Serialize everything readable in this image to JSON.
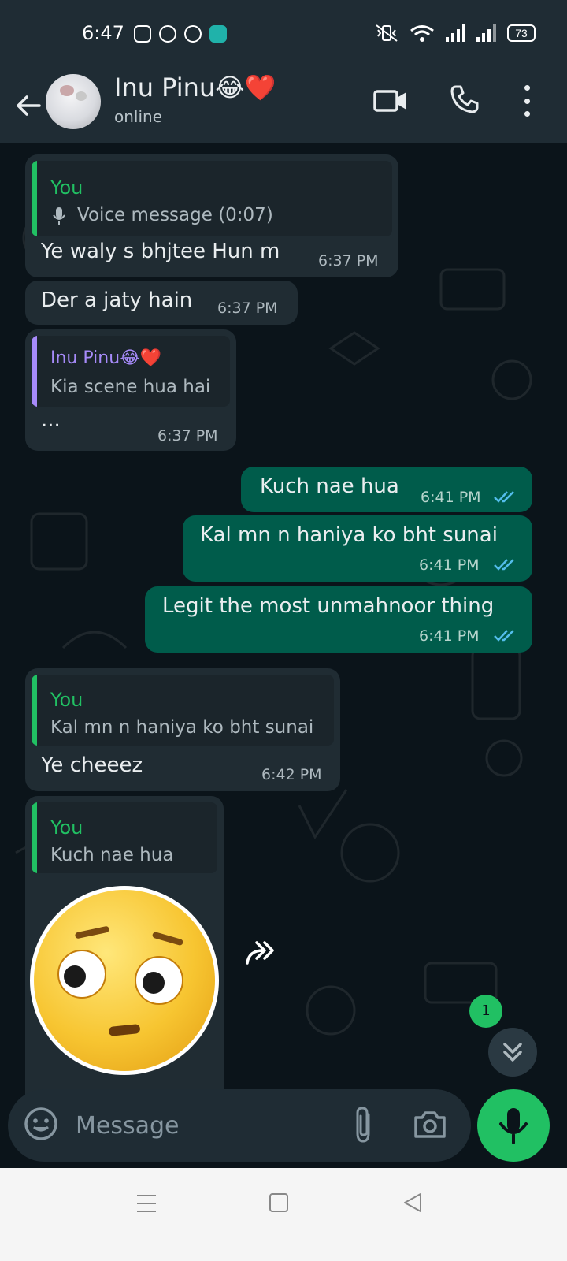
{
  "status_bar": {
    "time": "6:47",
    "battery": "73"
  },
  "header": {
    "contact_name": "Inu Pinu😂❤️",
    "contact_status": "online"
  },
  "messages": [
    {
      "quote_author": "You",
      "quote_text": "Voice message (0:07)",
      "text": "Ye waly s bhjtee Hun m",
      "time": "6:37 PM"
    },
    {
      "text": "Der a jaty hain",
      "time": "6:37 PM"
    },
    {
      "quote_author": "Inu Pinu😂❤️",
      "quote_text": "Kia scene hua hai",
      "text": "...",
      "time": "6:37 PM"
    },
    {
      "text": "Kuch nae hua",
      "time": "6:41 PM"
    },
    {
      "text": "Kal mn n haniya ko bht sunai",
      "time": "6:41 PM"
    },
    {
      "text": "Legit the most unmahnoor thing",
      "time": "6:41 PM"
    },
    {
      "quote_author": "You",
      "quote_text": "Kal mn n haniya ko bht sunai",
      "text": "Ye cheeez",
      "time": "6:42 PM"
    },
    {
      "quote_author": "You",
      "quote_text": "Kuch nae hua"
    }
  ],
  "unread_count": "1",
  "composer": {
    "placeholder": "Message"
  },
  "colors": {
    "accent_green": "#21c063",
    "outgoing_bubble": "#005c4b",
    "incoming_bubble": "#202c33",
    "quote_you": "#21c063",
    "quote_contact": "#a78bfa",
    "read_ticks": "#53bdeb"
  }
}
